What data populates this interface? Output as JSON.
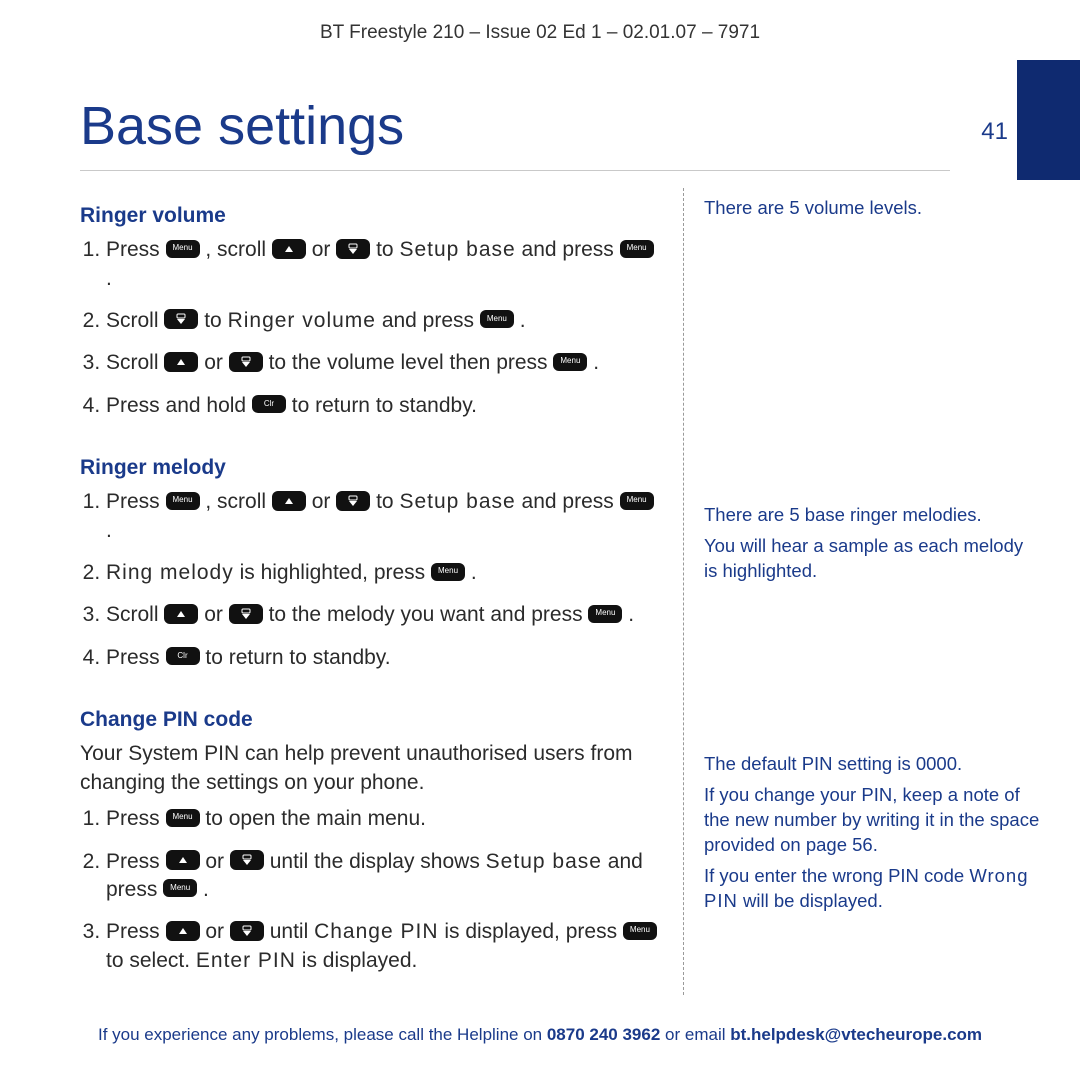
{
  "docheader": "BT Freestyle 210 – Issue 02 Ed 1 – 02.01.07 – 7971",
  "page_title": "Base settings",
  "page_number": "41",
  "sections": {
    "ringer_volume": {
      "heading": "Ringer volume",
      "step1_a": "Press ",
      "step1_b": " , scroll ",
      "step1_c": " or ",
      "step1_d": " to ",
      "step1_lcd": "Setup base",
      "step1_e": " and press ",
      "step1_f": " .",
      "step2_a": "Scroll ",
      "step2_b": " to ",
      "step2_lcd": "Ringer volume",
      "step2_c": " and press ",
      "step2_d": " .",
      "step3_a": "Scroll ",
      "step3_b": " or ",
      "step3_c": " to the volume level then press ",
      "step3_d": " .",
      "step4_a": "Press and hold ",
      "step4_b": " to return to standby."
    },
    "ringer_melody": {
      "heading": "Ringer melody",
      "step1_a": "Press ",
      "step1_b": " , scroll ",
      "step1_c": " or ",
      "step1_d": " to ",
      "step1_lcd": "Setup base",
      "step1_e": " and press ",
      "step1_f": " .",
      "step2_lcd": "Ring melody",
      "step2_a": " is highlighted, press ",
      "step2_b": " .",
      "step3_a": "Scroll ",
      "step3_b": " or ",
      "step3_c": " to the melody you want and press ",
      "step3_d": " .",
      "step4_a": "Press ",
      "step4_b": " to return to standby."
    },
    "change_pin": {
      "heading": "Change PIN code",
      "intro": "Your System PIN can help prevent unauthorised users from changing the settings on your phone.",
      "step1_a": "Press ",
      "step1_b": " to open the main menu.",
      "step2_a": "Press ",
      "step2_b": " or ",
      "step2_c": " until the display shows ",
      "step2_lcd": "Setup base",
      "step2_d": " and press ",
      "step2_e": " .",
      "step3_a": "Press ",
      "step3_b": " or ",
      "step3_c": " until ",
      "step3_lcd1": "Change PIN",
      "step3_d": " is displayed, press ",
      "step3_e": " to select. ",
      "step3_lcd2": "Enter PIN",
      "step3_f": " is displayed."
    }
  },
  "sidebar": {
    "volume_note": "There are 5 volume levels.",
    "melody_note_1": "There are 5 base ringer melodies.",
    "melody_note_2": "You will hear a sample as each melody is highlighted.",
    "pin_note_1": "The default PIN setting is 0000.",
    "pin_note_2": "If you change your PIN, keep a note of the new number by writing it in the space provided on page 56.",
    "pin_note_3a": "If you enter the wrong PIN code ",
    "pin_note_3_lcd": "Wrong PIN",
    "pin_note_3b": " will be displayed."
  },
  "footer": {
    "a": "If you experience any problems, please call the Helpline on ",
    "phone": "0870 240 3962",
    "b": " or email ",
    "email": "bt.helpdesk@vtecheurope.com"
  },
  "keys": {
    "menu_label": "Menu",
    "clr_label": "Clr"
  }
}
